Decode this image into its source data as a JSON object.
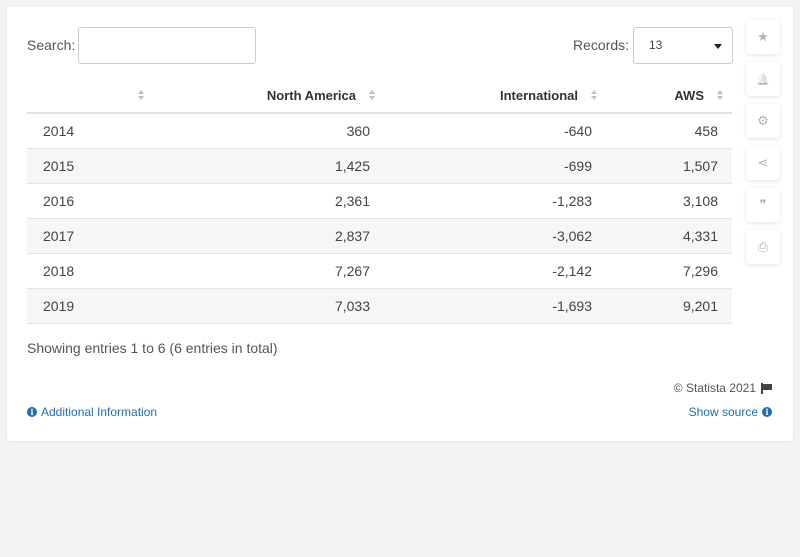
{
  "search": {
    "label": "Search:",
    "value": "",
    "placeholder": ""
  },
  "records": {
    "label": "Records:",
    "value": "13"
  },
  "table": {
    "headers": [
      "",
      "North America",
      "International",
      "AWS"
    ],
    "rows": [
      [
        "2014",
        "360",
        "-640",
        "458"
      ],
      [
        "2015",
        "1,425",
        "-699",
        "1,507"
      ],
      [
        "2016",
        "2,361",
        "-1,283",
        "3,108"
      ],
      [
        "2017",
        "2,837",
        "-3,062",
        "4,331"
      ],
      [
        "2018",
        "7,267",
        "-2,142",
        "7,296"
      ],
      [
        "2019",
        "7,033",
        "-1,693",
        "9,201"
      ]
    ]
  },
  "footer": {
    "showing": "Showing entries 1 to 6 (6 entries in total)",
    "copyright": "© Statista 2021",
    "additional_info": "Additional Information",
    "show_source": "Show source"
  },
  "tools": [
    {
      "icon": "star-icon",
      "glyph": "★"
    },
    {
      "icon": "bell-icon",
      "glyph": "🔔"
    },
    {
      "icon": "gear-icon",
      "glyph": "⚙"
    },
    {
      "icon": "share-icon",
      "glyph": "⋖"
    },
    {
      "icon": "quote-icon",
      "glyph": "❞"
    },
    {
      "icon": "print-icon",
      "glyph": "⎙"
    }
  ],
  "colors": {
    "link": "#1f6eb5",
    "stripe": "#f5f6f7",
    "icon": "#b0b4b8"
  }
}
